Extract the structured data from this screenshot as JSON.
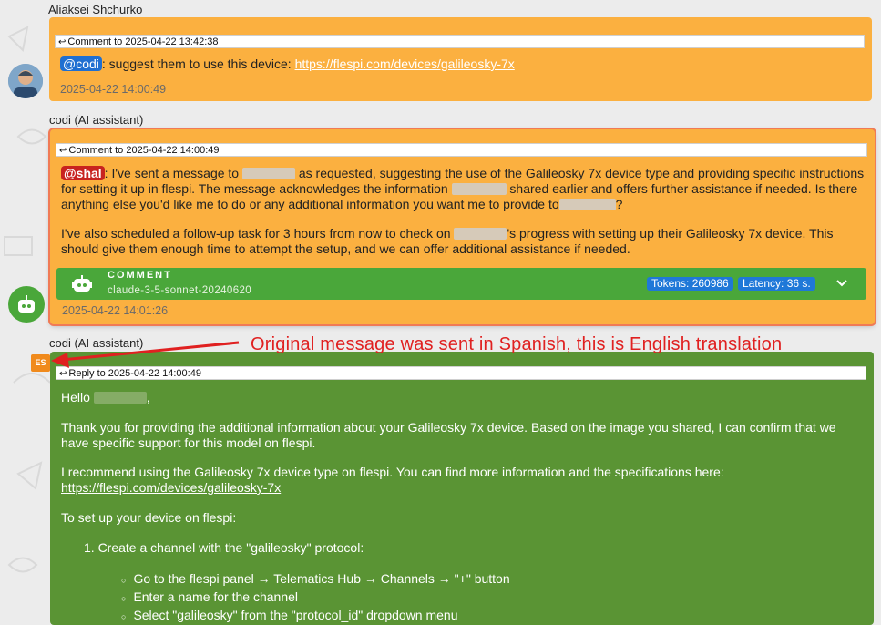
{
  "messages": [
    {
      "author": "Aliaksei Shchurko",
      "ref": "Comment to 2025-04-22 13:42:38",
      "mention": "@codi",
      "text": ": suggest them to use this device: ",
      "link": "https://flespi.com/devices/galileosky-7x",
      "timestamp": "2025-04-22 14:00:49"
    },
    {
      "author": "codi (AI assistant)",
      "ref": "Comment to 2025-04-22 14:00:49",
      "mention": "@shal",
      "p1_a": ": I've sent a message to ",
      "p1_b": " as requested, suggesting the use of the Galileosky 7x device type and providing specific instructions for setting it up in flespi. The message acknowledges the information ",
      "p1_c": " shared earlier and offers further assistance if needed. Is there anything else you'd like me to do or any additional information you want me to provide to",
      "p1_d": "?",
      "p2_a": "I've also scheduled a follow-up task for 3 hours from now to check on ",
      "p2_b": "'s progress with setting up their Galileosky 7x device. This should give them enough time to attempt the setup, and we can offer additional assistance if needed.",
      "bar_title": "COMMENT",
      "bar_model": "claude-3-5-sonnet-20240620",
      "tokens": "Tokens: 260986",
      "latency": "Latency: 36 s.",
      "timestamp": "2025-04-22 14:01:26"
    },
    {
      "author": "codi (AI assistant)",
      "lang": "ES",
      "ref": "Reply to 2025-04-22 14:00:49",
      "hello": "Hello ",
      "hello_end": ",",
      "p1": "Thank you for providing the additional information about your Galileosky 7x device. Based on the image you shared, I can confirm that we have specific support for this model on flespi.",
      "p2": "I recommend using the Galileosky 7x device type on flespi. You can find more information and the specifications here: ",
      "p2_link": "https://flespi.com/devices/galileosky-7x",
      "p3": "To set up your device on flespi:",
      "step1": "1. Create a channel with the \"galileosky\" protocol:",
      "sub": [
        "Go to the flespi panel → Telematics Hub → Channels → \"+\" button",
        "Enter a name for the channel",
        "Select \"galileosky\" from the \"protocol_id\" dropdown menu"
      ]
    }
  ],
  "annotation": "Original message was sent in Spanish, this is English translation",
  "colors": {
    "orange": "#fbb040",
    "green": "#5a9434",
    "ai_bar": "#4aa73a",
    "badge_blue": "#1f78d8",
    "annotation_red": "#e02020"
  }
}
